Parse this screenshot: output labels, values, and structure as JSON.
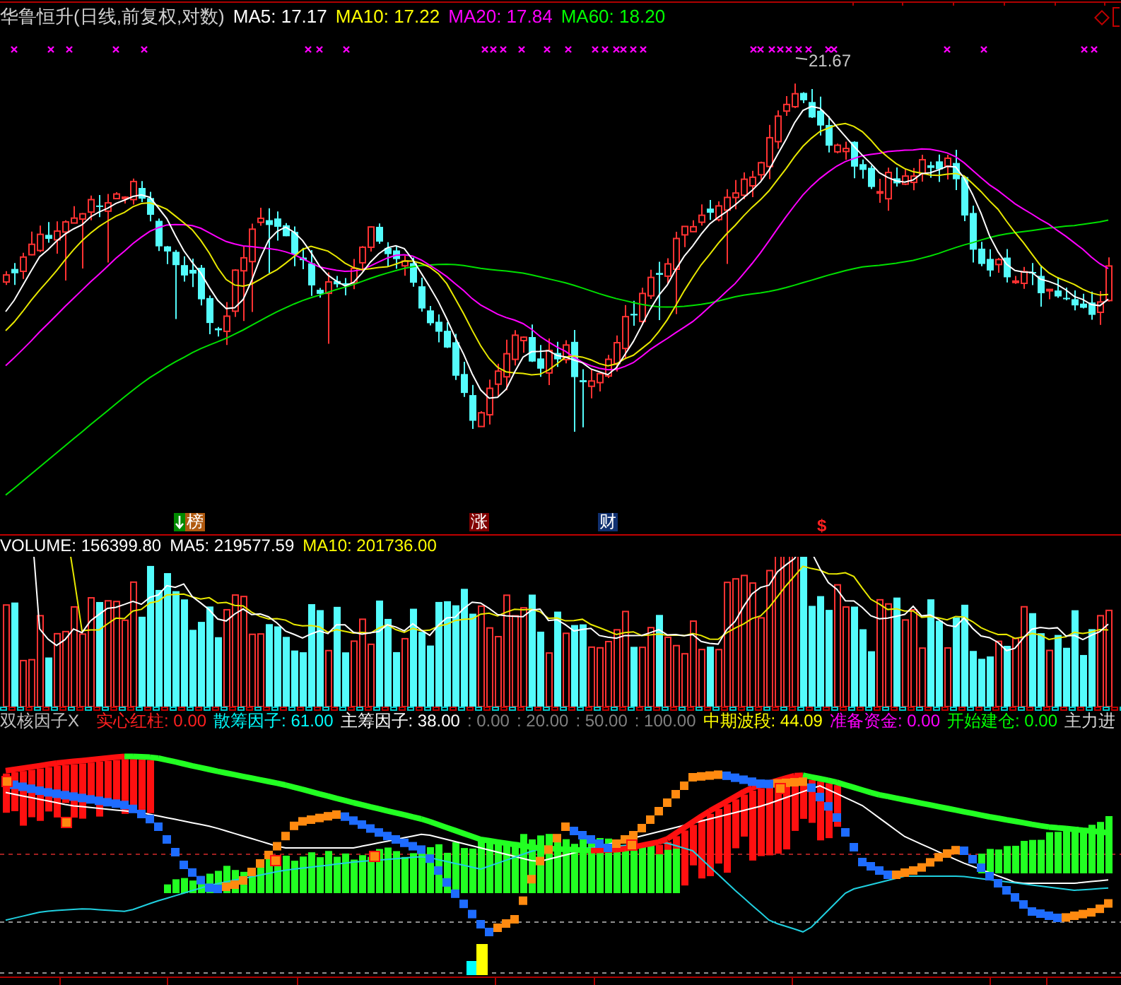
{
  "main_chart": {
    "stock_name": "华鲁恒升(日线,前复权,对数)",
    "indicators": [
      {
        "label": "MA5: 17.17",
        "color": "#ffffff"
      },
      {
        "label": "MA10: 17.22",
        "color": "#ffff00"
      },
      {
        "label": "MA20: 17.84",
        "color": "#ff00ff"
      },
      {
        "label": "MA60: 18.20",
        "color": "#00ff00"
      }
    ],
    "peak_label": "21.67",
    "event_markers": [
      {
        "kind": "ranking",
        "text": "榜"
      },
      {
        "kind": "rise",
        "text": "涨"
      },
      {
        "kind": "finance",
        "text": "财"
      },
      {
        "kind": "dollar",
        "text": "$"
      }
    ]
  },
  "volume_panel": {
    "indicators": [
      {
        "label": "VOLUME: 156399.80",
        "color": "#ffffff"
      },
      {
        "label": "MA5: 219577.59",
        "color": "#ffffff"
      },
      {
        "label": "MA10: 201736.00",
        "color": "#ffff00"
      }
    ]
  },
  "indicator_panel": {
    "name": "双核因子X",
    "indicators": [
      {
        "label": "实心红柱: 0.00",
        "color": "#ff2020"
      },
      {
        "label": "散筹因子: 61.00",
        "color": "#00ffff"
      },
      {
        "label": "主筹因子: 38.00",
        "color": "#ffffff"
      },
      {
        "label": ": 0.00",
        "color": "#808080"
      },
      {
        "label": ": 20.00",
        "color": "#808080"
      },
      {
        "label": ": 50.00",
        "color": "#808080"
      },
      {
        "label": ": 100.00",
        "color": "#808080"
      },
      {
        "label": "中期波段: 44.09",
        "color": "#ffff00"
      },
      {
        "label": "准备资金: 0.00",
        "color": "#ff00ff"
      },
      {
        "label": "开始建仓: 0.00",
        "color": "#00ff00"
      },
      {
        "label": "主力进",
        "color": "#d8d8d8"
      }
    ]
  }
}
